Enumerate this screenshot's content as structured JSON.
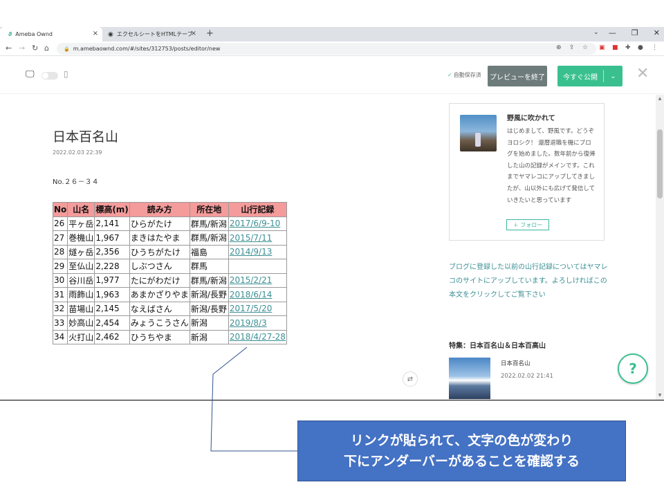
{
  "browser": {
    "tabs": [
      {
        "title": "Ameba Ownd",
        "close": "×"
      },
      {
        "title": "エクセルシートをHTMLテーブルに変換",
        "close": "×"
      }
    ],
    "new_tab": "+",
    "url": "m.amebaownd.com/#/sites/312753/posts/editor/new",
    "window_controls": [
      "—",
      "❐",
      "✕"
    ]
  },
  "editor": {
    "autosave": "自動保存済",
    "preview_end": "プレビューを終了",
    "publish": "今すぐ公開"
  },
  "post": {
    "title": "日本百名山",
    "date": "2022.02.03 22:39",
    "lead": "No.２６－３４",
    "table": {
      "headers": [
        "No",
        "山名",
        "標高(m)",
        "読み方",
        "所在地",
        "山行記録"
      ],
      "rows": [
        {
          "no": "26",
          "name": "平ヶ岳",
          "height": "2,141",
          "reading": "ひらがたけ",
          "location": "群馬/新潟",
          "record": "2017/6/9-10"
        },
        {
          "no": "27",
          "name": "巻機山",
          "height": "1,967",
          "reading": "まきはたやま",
          "location": "群馬/新潟",
          "record": "2015/7/11"
        },
        {
          "no": "28",
          "name": "燧ヶ岳",
          "height": "2,356",
          "reading": "ひうちがたけ",
          "location": "福島",
          "record": "2014/9/13"
        },
        {
          "no": "29",
          "name": "至仏山",
          "height": "2,228",
          "reading": "しぶつさん",
          "location": "群馬",
          "record": ""
        },
        {
          "no": "30",
          "name": "谷川岳",
          "height": "1,977",
          "reading": "たにがわだけ",
          "location": "群馬/新潟",
          "record": "2015/2/21"
        },
        {
          "no": "31",
          "name": "雨飾山",
          "height": "1,963",
          "reading": "あまかざりやま",
          "location": "新潟/長野",
          "record": "2018/6/14"
        },
        {
          "no": "32",
          "name": "苗場山",
          "height": "2,145",
          "reading": "なえばさん",
          "location": "新潟/長野",
          "record": "2017/5/20"
        },
        {
          "no": "33",
          "name": "妙高山",
          "height": "2,454",
          "reading": "みょうこうさん",
          "location": "新潟",
          "record": "2019/8/3"
        },
        {
          "no": "34",
          "name": "火打山",
          "height": "2,462",
          "reading": "ひうちやま",
          "location": "新潟",
          "record": "2018/4/27-28"
        }
      ]
    }
  },
  "sidebar": {
    "profile_name": "野風に吹かれて",
    "profile_bio": "はじめまして、野風です。どうぞヨロシク！ 還暦退職を機にブログを始めました。数年前から復帰した山の記録がメインです。これまでヤマレコにアップしてきましたが、山以外にも広げて発信していきたいと思っています",
    "follow": "＋ フォロー",
    "note": "ブログに登録した以前の山行記録についてはヤマレコのサイトにアップしています。よろしければこの本文をクリックしてご覧下さい",
    "feature_heading": "特集：日本百名山＆日本百高山",
    "feature_title": "日本百名山",
    "feature_date": "2022.02.02 21:41"
  },
  "help": "?",
  "annotation": {
    "line1": "リンクが貼られて、文字の色が変わり",
    "line2": "下にアンダーバーがあることを確認する"
  },
  "colors": {
    "header_bg": "#f49b9b",
    "link": "#3b8f94",
    "accent_green": "#3ac08f",
    "callout_blue": "#4472c4"
  }
}
